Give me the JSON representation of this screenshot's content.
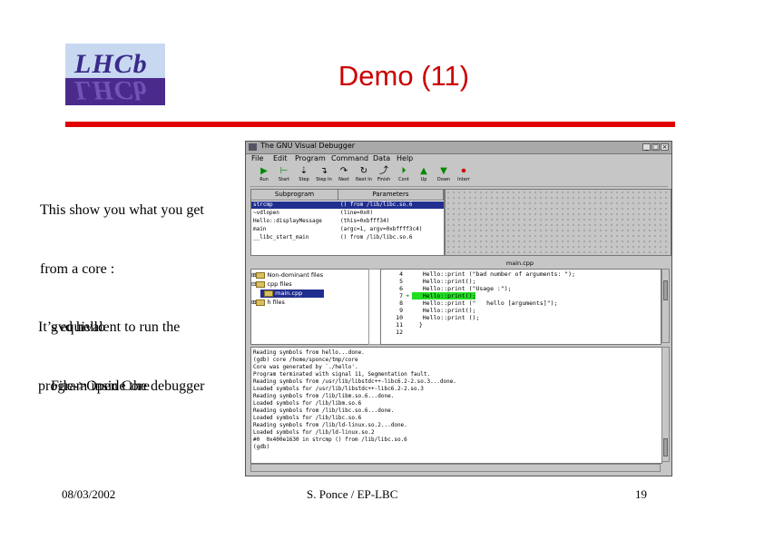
{
  "slide": {
    "logo_text": "LHCb",
    "title": "Demo (11)",
    "paragraph1": [
      "This show you what you get",
      "from a core :",
      "   gvd hello",
      "   File->Open Core"
    ],
    "paragraph2": [
      "It’s equivalent to run the",
      "program inside the debugger"
    ],
    "footer": {
      "date": "08/03/2002",
      "author": "S. Ponce / EP-LBC",
      "page": "19"
    },
    "accent_color": "#e00000",
    "title_color": "#cc0000"
  },
  "debugger": {
    "window_title": "The GNU Visual Debugger",
    "menu": [
      "File",
      "Edit",
      "Program",
      "Command",
      "Data",
      "Help"
    ],
    "toolbar": [
      {
        "label": "Run",
        "icon": "run-icon"
      },
      {
        "label": "Start",
        "icon": "start-icon"
      },
      {
        "label": "Step",
        "icon": "step-icon"
      },
      {
        "label": "Step In",
        "icon": "step-in-icon"
      },
      {
        "label": "Next",
        "icon": "next-icon"
      },
      {
        "label": "Next In",
        "icon": "next-in-icon"
      },
      {
        "label": "Finish",
        "icon": "finish-icon"
      },
      {
        "label": "Cont",
        "icon": "cont-icon"
      },
      {
        "label": "Up",
        "icon": "up-icon"
      },
      {
        "label": "Down",
        "icon": "down-icon"
      },
      {
        "label": "Interr",
        "icon": "interrupt-icon"
      }
    ],
    "stack_headers": [
      "Subprogram",
      "Parameters"
    ],
    "stack_rows": [
      {
        "sub": "strcmp",
        "params": "() from /lib/libc.so.6"
      },
      {
        "sub": "~vdlopen",
        "params": "(line=0x0)"
      },
      {
        "sub": "Hello::displayMessage",
        "params": "(this=0xbfff34)"
      },
      {
        "sub": "main",
        "params": "(argc=1, argv=0xbffff3c4)"
      },
      {
        "sub": "__libc_start_main",
        "params": "() from /lib/libc.so.6"
      }
    ],
    "file_tree": [
      {
        "label": "Non-dominant files",
        "prefix": "⊞"
      },
      {
        "label": "cpp files",
        "prefix": "⊟"
      },
      {
        "label": "main.cpp",
        "prefix": "  ",
        "selected": true
      },
      {
        "label": "h files",
        "prefix": "⊞"
      }
    ],
    "code_title": "main.cpp",
    "code_lines": [
      {
        "n": "4",
        "mark": "",
        "text": "   Hello::print (\"bad number of arguments: \");"
      },
      {
        "n": "5",
        "mark": "",
        "text": "   Hello::print();"
      },
      {
        "n": "6",
        "mark": "",
        "text": "   Hello::print (\"Usage :\");"
      },
      {
        "n": "7",
        "mark": "➜",
        "text": "   Hello::print();",
        "highlight": true
      },
      {
        "n": "8",
        "mark": "",
        "text": "   Hello::print (\"   hello [arguments]\");"
      },
      {
        "n": "9",
        "mark": "",
        "text": "   Hello::print();"
      },
      {
        "n": "10",
        "mark": "",
        "text": "   Hello::print ();"
      },
      {
        "n": "11",
        "mark": "",
        "text": "  }"
      },
      {
        "n": "12",
        "mark": "",
        "text": ""
      }
    ],
    "console_lines": [
      "Reading symbols from hello...done.",
      "(gdb) core /home/sponce/tmp/core",
      "Core was generated by `./hello'.",
      "Program terminated with signal 11, Segmentation fault.",
      "Reading symbols from /usr/lib/libstdc++-libc6.2-2.so.3...done.",
      "Loaded symbols for /usr/lib/libstdc++-libc6.2-2.so.3",
      "Reading symbols from /lib/libm.so.6...done.",
      "Loaded symbols for /lib/libm.so.6",
      "Reading symbols from /lib/libc.so.6...done.",
      "Loaded symbols for /lib/libc.so.6",
      "Reading symbols from /lib/ld-linux.so.2...done.",
      "Loaded symbols for /lib/ld-linux.so.2",
      "#0  0x400e1630 in strcmp () from /lib/libc.so.6",
      "(gdb)"
    ]
  }
}
